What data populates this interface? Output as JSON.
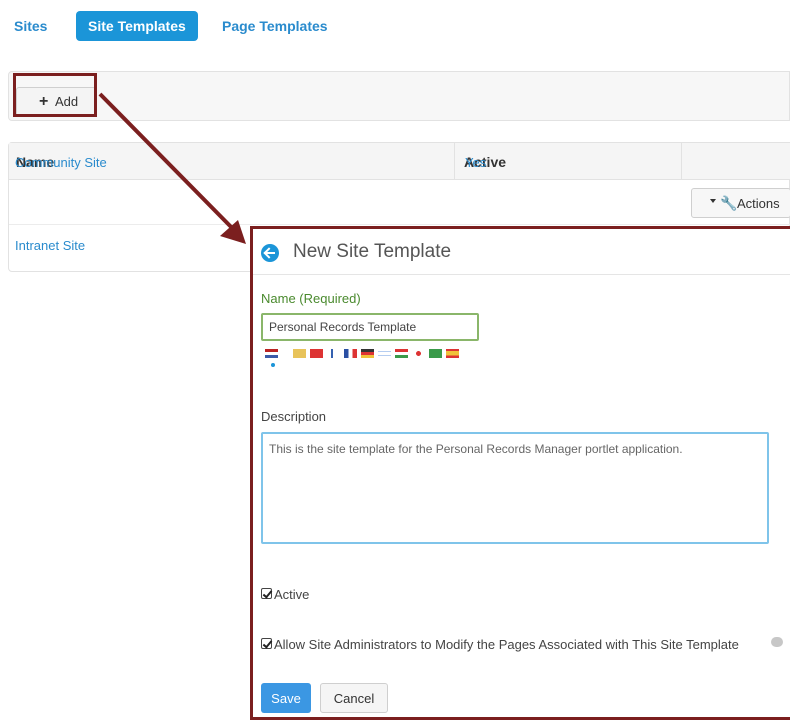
{
  "nav": {
    "tabs": [
      {
        "label": "Sites"
      },
      {
        "label": "Site Templates"
      },
      {
        "label": "Page Templates"
      }
    ]
  },
  "toolbar": {
    "add_label": "Add",
    "add_icon": "plus-icon"
  },
  "table": {
    "headers": [
      "Name",
      "Active",
      ""
    ],
    "rows": [
      {
        "name": "Community Site",
        "active": "Yes",
        "actions_label": "Actions"
      },
      {
        "name": "Intranet Site",
        "active": "",
        "actions_label": ""
      }
    ]
  },
  "dialog": {
    "title": "New Site Template",
    "back_icon": "back-arrow-icon",
    "name_label": "Name (Required)",
    "name_value": "Personal Records Template",
    "description_label": "Description",
    "description_value": "This is the site template for the Personal Records Manager portlet application.",
    "active_label": "Active",
    "allow_modify_label": "Allow Site Administrators to Modify the Pages Associated with This Site Template",
    "save_label": "Save",
    "cancel_label": "Cancel"
  },
  "colors": {
    "accent": "#1b95d8",
    "link": "#2a8bcd",
    "annotation": "#7b1f1f",
    "required_label": "#4a8a2e"
  }
}
